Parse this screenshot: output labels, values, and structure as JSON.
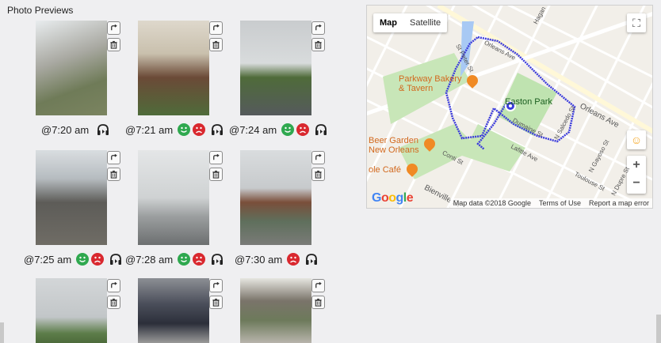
{
  "section_title": "Photo Previews",
  "photos": [
    {
      "time": "@7:20 am",
      "moods": [],
      "audio": true
    },
    {
      "time": "@7:21 am",
      "moods": [
        "happy",
        "sad"
      ],
      "audio": true
    },
    {
      "time": "@7:24 am",
      "moods": [
        "happy",
        "sad"
      ],
      "audio": true
    },
    {
      "time": "@7:25 am",
      "moods": [
        "happy",
        "sad"
      ],
      "audio": true
    },
    {
      "time": "@7:28 am",
      "moods": [
        "happy",
        "sad"
      ],
      "audio": true
    },
    {
      "time": "@7:30 am",
      "moods": [
        "sad"
      ],
      "audio": true
    },
    {
      "time": "",
      "moods": [],
      "audio": false
    },
    {
      "time": "",
      "moods": [],
      "audio": false
    },
    {
      "time": "",
      "moods": [],
      "audio": false
    }
  ],
  "map": {
    "type_buttons": {
      "map": "Map",
      "satellite": "Satellite"
    },
    "pois": {
      "parkway": "Parkway Bakery & Tavern",
      "beer_garden": "Beer Garden New Orleans",
      "cafe": "ole Café",
      "park": "Easton Park"
    },
    "streets": {
      "orleans_ave_1": "Orleans Ave",
      "orleans_ave_2": "Orleans Ave",
      "lafitte": "Lafitte Ave",
      "conti": "Conti St",
      "bienville": "Bienville St",
      "toulouse": "Toulouse St",
      "st_peter": "St Peter St",
      "n_gayoso": "N Gayoso St",
      "n_dupre": "N Dupre St",
      "n_salcedo": "N Salcedo St",
      "hagan": "Hagan",
      "dumaine": "Dumaine St"
    },
    "zoom_in": "+",
    "zoom_out": "−",
    "footer": {
      "data": "Map data ©2018 Google",
      "terms": "Terms of Use",
      "report": "Report a map error"
    },
    "logo": "Google"
  },
  "colors": {
    "happy": "#2fa84f",
    "sad": "#d9282f",
    "route": "#3b3bdc",
    "park": "#bfe3b0"
  }
}
